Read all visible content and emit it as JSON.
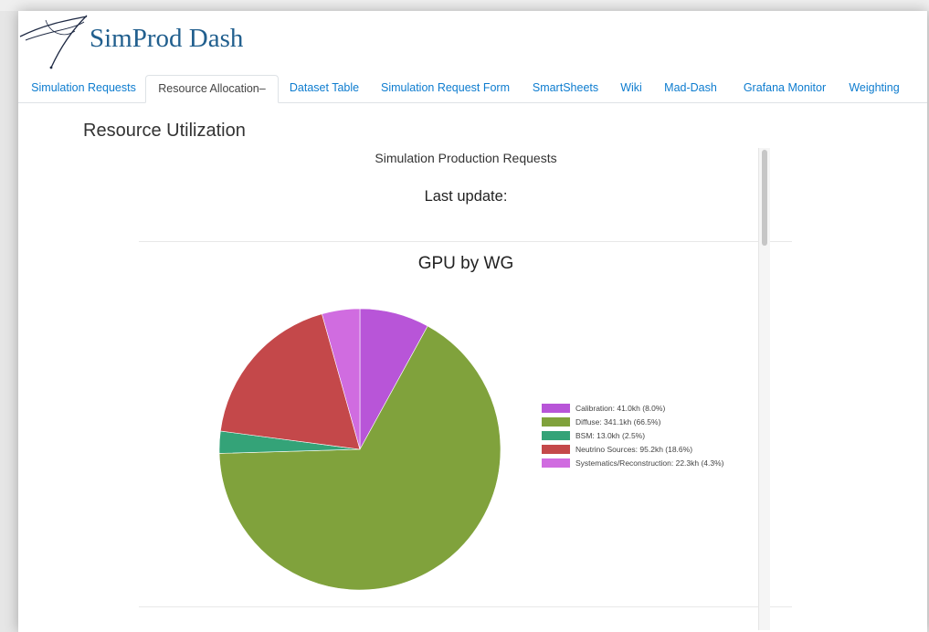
{
  "header": {
    "brand": "SimProd Dash",
    "logo_icon": "comet-logo-icon"
  },
  "nav": {
    "tabs": [
      {
        "label": "Simulation Requests",
        "active": false
      },
      {
        "label": "Resource Allocation–",
        "active": true
      },
      {
        "label": "Dataset Table",
        "active": false
      },
      {
        "label": "Simulation Request Form",
        "active": false
      },
      {
        "label": "SmartSheets",
        "active": false
      },
      {
        "label": "Wiki",
        "active": false
      },
      {
        "label": "Mad-Dash",
        "active": false
      },
      {
        "label": "Grafana Monitor",
        "active": false
      },
      {
        "label": "Weighting",
        "active": false
      }
    ]
  },
  "page": {
    "title": "Resource Utilization",
    "panel_title": "Simulation Production Requests",
    "last_update": "Last update:"
  },
  "colors": {
    "link": "#0d7ccf",
    "brand": "#215f8e"
  },
  "chart_data": {
    "type": "pie",
    "title": "GPU by WG",
    "unit": "kh",
    "slices": [
      {
        "name": "Calibration",
        "value": 41.0,
        "percent": 8.0,
        "color": "#b855d8",
        "label": "Calibration: 41.0kh (8.0%)"
      },
      {
        "name": "Diffuse",
        "value": 341.1,
        "percent": 66.5,
        "color": "#80a23c",
        "label": "Diffuse: 341.1kh (66.5%)"
      },
      {
        "name": "BSM",
        "value": 13.0,
        "percent": 2.5,
        "color": "#34a378",
        "label": "BSM: 13.0kh (2.5%)"
      },
      {
        "name": "Neutrino Sources",
        "value": 95.2,
        "percent": 18.6,
        "color": "#c4484a",
        "label": "Neutrino Sources: 95.2kh (18.6%)"
      },
      {
        "name": "Systematics/Reconstruction",
        "value": 22.3,
        "percent": 4.3,
        "color": "#d06ce0",
        "label": "Systematics/Reconstruction: 22.3kh (4.3%)"
      }
    ],
    "legend_position": "right"
  }
}
